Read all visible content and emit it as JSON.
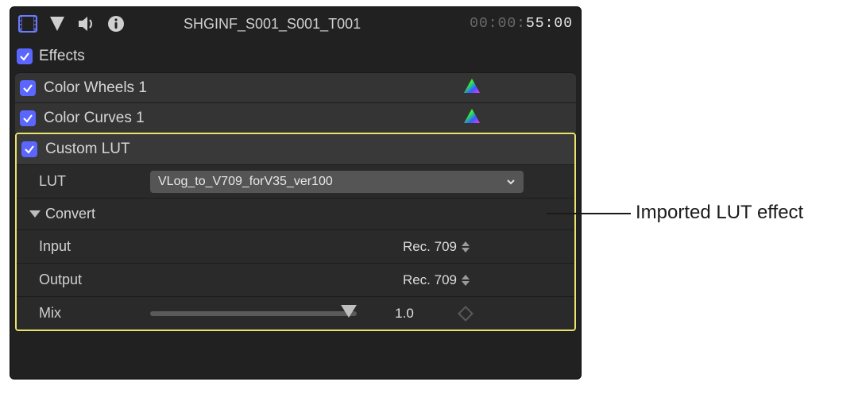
{
  "header": {
    "clip_name": "SHGINF_S001_S001_T001",
    "timecode_gray": "00:00:",
    "timecode_white": "55:00"
  },
  "effects": {
    "title": "Effects",
    "items": [
      {
        "label": "Color Wheels 1"
      },
      {
        "label": "Color Curves 1"
      }
    ]
  },
  "custom_lut": {
    "title": "Custom LUT",
    "lut_label": "LUT",
    "lut_value": "VLog_to_V709_forV35_ver100",
    "convert_label": "Convert",
    "input_label": "Input",
    "input_value": "Rec. 709",
    "output_label": "Output",
    "output_value": "Rec. 709",
    "mix_label": "Mix",
    "mix_value": "1.0"
  },
  "callout": {
    "text": "Imported LUT effect"
  }
}
